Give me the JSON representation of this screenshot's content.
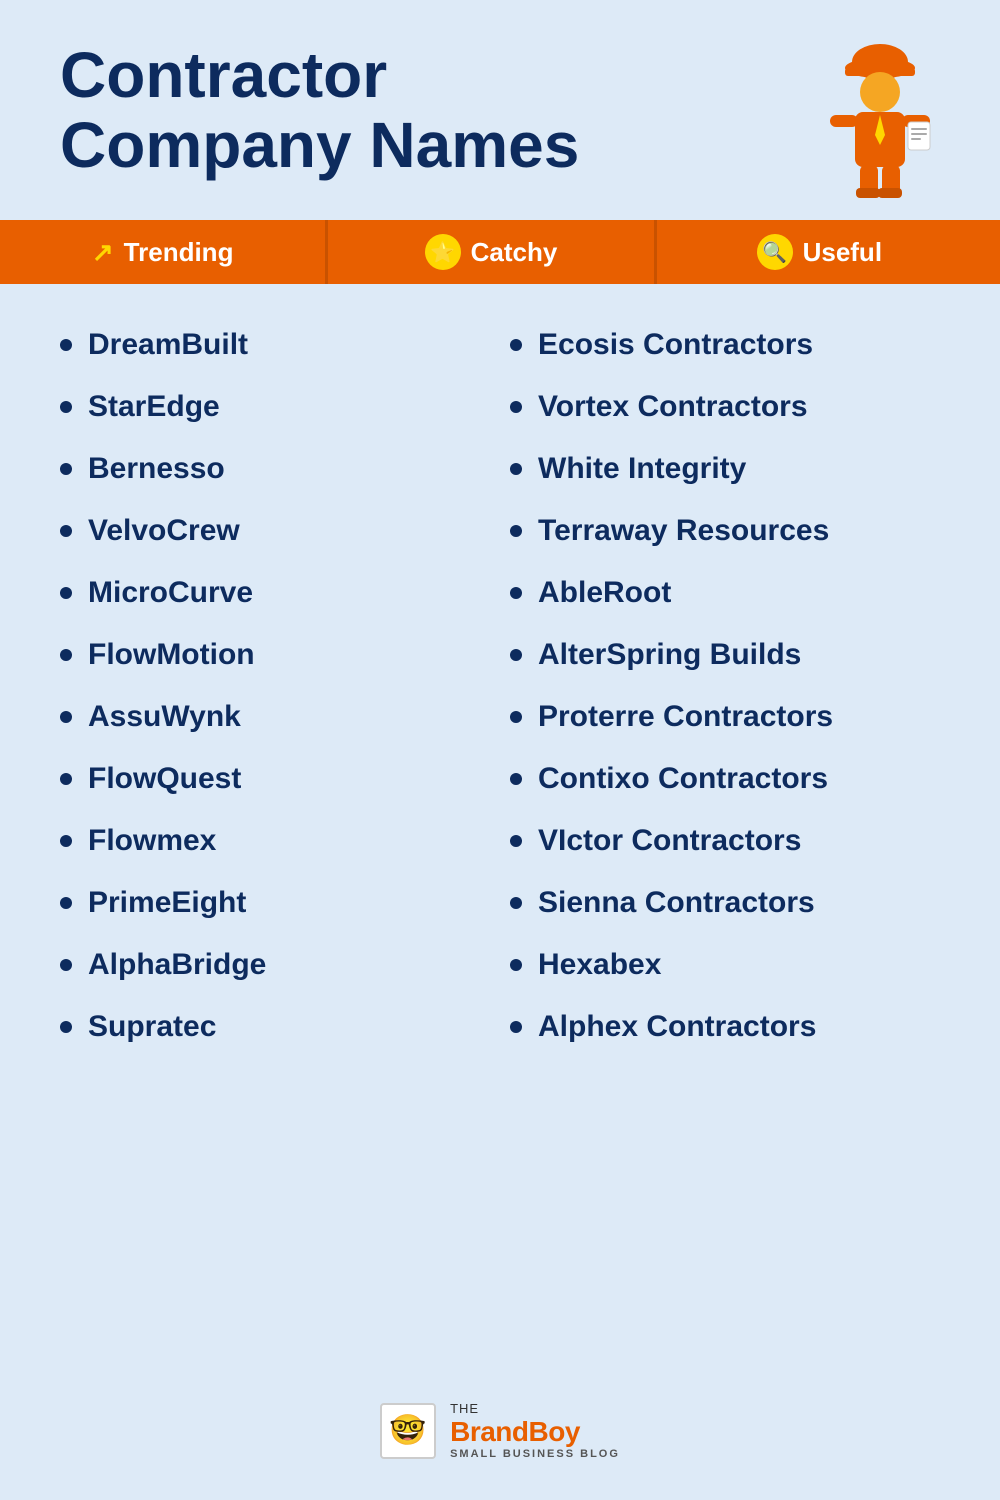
{
  "header": {
    "title_line1": "Contractor",
    "title_line2": "Company Names"
  },
  "tabs": [
    {
      "id": "trending",
      "label": "Trending",
      "icon": "trending"
    },
    {
      "id": "catchy",
      "label": "Catchy",
      "icon": "star"
    },
    {
      "id": "useful",
      "label": "Useful",
      "icon": "search"
    }
  ],
  "names_left": [
    "DreamBuilt",
    "StarEdge",
    "Bernesso",
    "VelvoCrew",
    "MicroCurve",
    "FlowMotion",
    "AssuWynk",
    "FlowQuest",
    "Flowmex",
    "PrimeEight",
    "AlphaBridge",
    "Supratec"
  ],
  "names_right": [
    "Ecosis Contractors",
    "Vortex Contractors",
    "White Integrity",
    "Terraway Resources",
    "AbleRoot",
    "AlterSpring Builds",
    "Proterre Contractors",
    "Contixo Contractors",
    "VIctor Contractors",
    "Sienna Contractors",
    "Hexabex",
    "Alphex Contractors"
  ],
  "footer": {
    "the": "the",
    "brand": "Brand",
    "boy": "Boy",
    "subtitle": "SMALL BUSINESS BLOG",
    "logo_emoji": "🤓"
  }
}
